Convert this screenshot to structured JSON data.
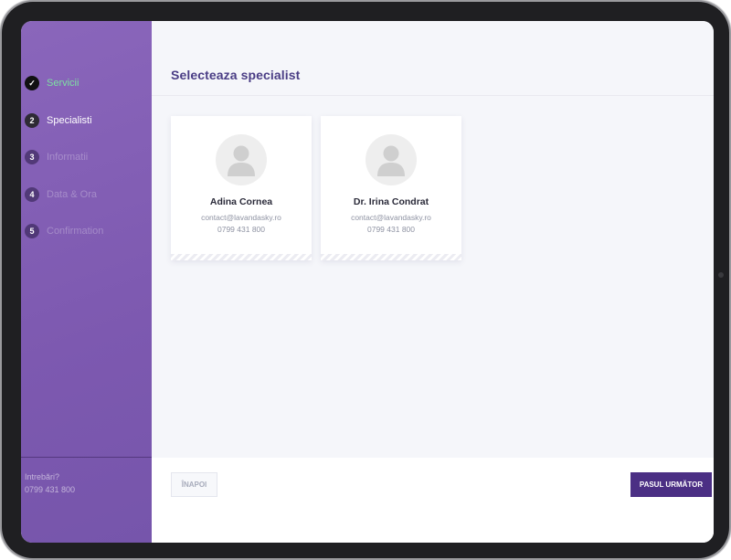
{
  "sidebar": {
    "steps": [
      {
        "number": "✓",
        "label": "Servicii"
      },
      {
        "number": "2",
        "label": "Specialisti"
      },
      {
        "number": "3",
        "label": "Informatii"
      },
      {
        "number": "4",
        "label": "Data & Ora"
      },
      {
        "number": "5",
        "label": "Confirmation"
      }
    ],
    "help_title": "Intrebări?",
    "help_phone": "0799 431 800"
  },
  "main": {
    "title": "Selecteaza specialist",
    "specialists": [
      {
        "name": "Adina Cornea",
        "email": "contact@lavandasky.ro",
        "phone": "0799 431 800",
        "avatar_icon": "user-placeholder-icon"
      },
      {
        "name": "Dr. Irina Condrat",
        "email": "contact@lavandasky.ro",
        "phone": "0799 431 800",
        "avatar_icon": "user-placeholder-icon"
      }
    ]
  },
  "footer": {
    "back_label": "ÎNAPOI",
    "next_label": "PASUL URMĂTOR"
  },
  "colors": {
    "sidebar": "#8a66bb",
    "accent": "#4b2f84",
    "done": "#7ee0a2",
    "title": "#4a3d85"
  }
}
